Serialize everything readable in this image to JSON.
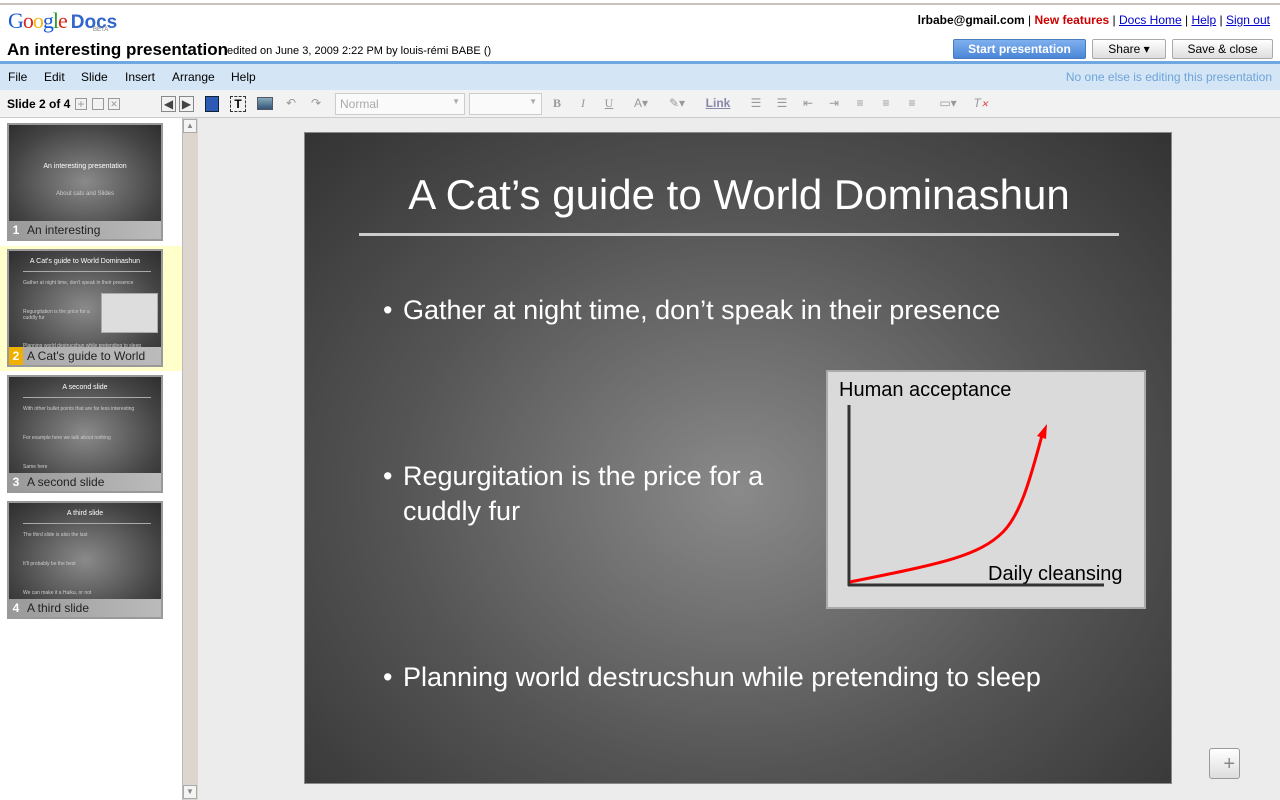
{
  "header": {
    "logo": "Google",
    "logo_docs": "Docs",
    "beta": "BETA",
    "title": "An interesting presentation",
    "edited": "edited on June 3, 2009 2:22 PM by louis-rémi BABE ()",
    "user": "lrbabe@gmail.com",
    "links": {
      "new_features": "New features",
      "docs_home": "Docs Home",
      "help": "Help",
      "sign_out": "Sign out"
    },
    "start": "Start presentation",
    "share": "Share ▾",
    "save": "Save & close"
  },
  "menu": {
    "items": [
      "File",
      "Edit",
      "Slide",
      "Insert",
      "Arrange",
      "Help"
    ],
    "status": "No one else is editing this presentation"
  },
  "toolbar": {
    "slide_count": "Slide 2 of 4",
    "style": "Normal",
    "size": "",
    "link": "Link",
    "bold": "B",
    "italic": "I",
    "underline": "U"
  },
  "thumbs": [
    {
      "num": "1",
      "label": "An interesting",
      "title": "An interesting presentation",
      "sub": "About cats and Slides"
    },
    {
      "num": "2",
      "label": "A Cat's guide to World",
      "title": "A Cat's guide to World Dominashun",
      "bullets": [
        "Gather at night time, don't speak in their presence",
        "Regurgitation is the price for a cuddly fur",
        "Planning world destrucshun while pretending to sleep"
      ]
    },
    {
      "num": "3",
      "label": "A second slide",
      "title": "A second slide",
      "bullets": [
        "With other bullet points that are far less interesting",
        "For example here we talk about nothing",
        "Same here"
      ]
    },
    {
      "num": "4",
      "label": "A third slide",
      "title": "A third slide",
      "bullets": [
        "The third slide is also the last",
        "It'll probably be the best",
        "We can make it a Haiku, or not"
      ]
    }
  ],
  "slide": {
    "title": "A Cat’s guide to World Dominashun",
    "bullets": [
      "Gather at night time, don’t speak in their presence",
      "Regurgitation is the price for a",
      "cuddly fur",
      "Planning world destrucshun while pretending to sleep"
    ],
    "chart": {
      "ylabel": "Human acceptance",
      "xlabel": "Daily cleansing",
      "line_color": "#ff0000"
    }
  },
  "colors": {
    "accent": "#4a86d8",
    "menubar": "#d4e6f6",
    "selected": "#ffffcc"
  }
}
